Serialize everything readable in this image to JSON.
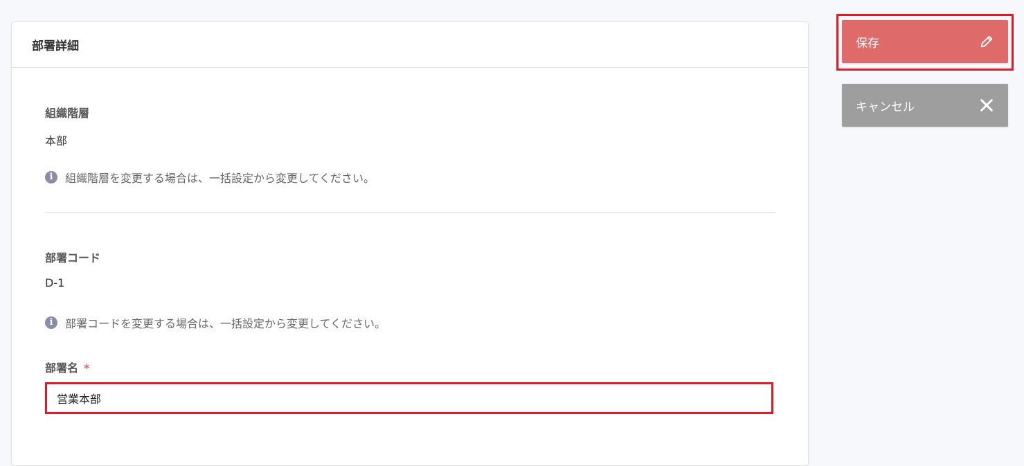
{
  "card": {
    "title": "部署詳細"
  },
  "org_level": {
    "label": "組織階層",
    "value": "本部",
    "note": "組織階層を変更する場合は、一括設定から変更してください。"
  },
  "dept_code": {
    "label": "部署コード",
    "value": "D-1",
    "note": "部署コードを変更する場合は、一括設定から変更してください。"
  },
  "dept_name": {
    "label": "部署名",
    "required_mark": "*",
    "value": "営業本部"
  },
  "actions": {
    "save_label": "保存",
    "cancel_label": "キャンセル"
  },
  "colors": {
    "save_button": "#df6a6a",
    "cancel_button": "#9e9e9e",
    "highlight": "#e01b24",
    "info_icon": "#8a8ea8"
  },
  "icons": {
    "save": "pencil-icon",
    "cancel": "close-icon",
    "note": "info-icon"
  }
}
